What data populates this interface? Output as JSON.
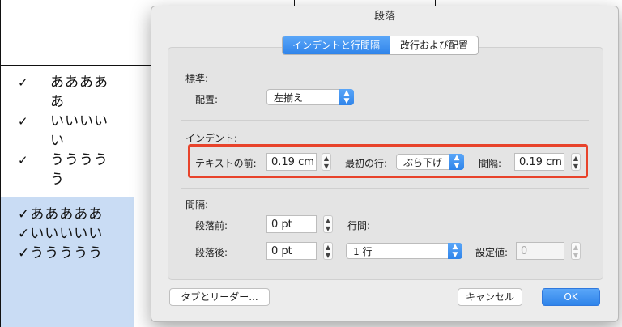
{
  "document": {
    "cells": {
      "line1a": "ああああ",
      "line1b": "あ",
      "line2a": "いいいい",
      "line2b": "い",
      "line3a": "うううう",
      "line3b": "う",
      "check": "✓",
      "blue_line1": "✓あああああ",
      "blue_line2": "✓いいいいい",
      "blue_line3": "✓ううううう"
    }
  },
  "dialog": {
    "title": "段落",
    "tabs": {
      "indent_spacing": "インデントと行間隔",
      "line_page_breaks": "改行および配置"
    },
    "general": {
      "section": "標準:",
      "alignment_label": "配置:",
      "alignment_value": "左揃え"
    },
    "indentation": {
      "section": "インデント:",
      "before_text_label": "テキストの前:",
      "before_text_value": "0.19 cm",
      "special_label": "最初の行:",
      "special_value": "ぶら下げ",
      "by_label": "間隔:",
      "by_value": "0.19 cm"
    },
    "spacing": {
      "section": "間隔:",
      "before_label": "段落前:",
      "before_value": "0 pt",
      "after_label": "段落後:",
      "after_value": "0 pt",
      "line_spacing_label": "行間:",
      "line_spacing_value": "1 行",
      "at_label": "設定値:",
      "at_value": "0"
    },
    "buttons": {
      "tabs": "タブとリーダー...",
      "cancel": "キャンセル",
      "ok": "OK"
    }
  },
  "colors": {
    "accent": "#2f84ea",
    "highlight": "#e8432b",
    "selection": "#c9dcf4"
  }
}
